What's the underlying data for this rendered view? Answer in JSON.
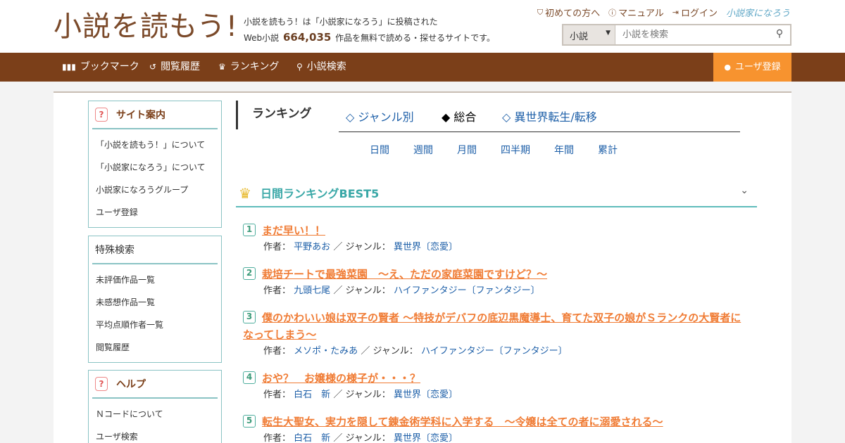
{
  "header": {
    "logo_main": "小説を読もう",
    "logo_mark": "!",
    "tagline_line1": "小説を読もう！は「小説家になろう」に投稿された",
    "tagline_prefix": "Web小説",
    "work_count": "664,035",
    "tagline_suffix": "作品を無料で読める・探せるサイトです。",
    "links": [
      "初めての方へ",
      "マニュアル",
      "ログイン"
    ],
    "partner_logo": "小説家になろう",
    "search": {
      "type": "小説",
      "placeholder": "小説を検索"
    }
  },
  "nav": {
    "items": [
      "ブックマーク",
      "閲覧履歴",
      "ランキング",
      "小説検索"
    ],
    "register": "ユーザ登録"
  },
  "sidebar": {
    "site_guide": {
      "title": "サイト案内",
      "items": [
        "「小説を読もう！」について",
        "「小説家になろう」について",
        "小説家になろうグループ",
        "ユーザ登録"
      ]
    },
    "special_search": {
      "title": "特殊検索",
      "items": [
        "未評価作品一覧",
        "未感想作品一覧",
        "平均点順作者一覧",
        "閲覧履歴"
      ]
    },
    "help": {
      "title": "ヘルプ",
      "items": [
        "Ｎコードについて",
        "ユーザ検索"
      ]
    }
  },
  "ranking": {
    "heading": "ランキング",
    "tabs": [
      "◇ ジャンル別",
      "◆ 総合",
      "◇ 異世界転生/転移"
    ],
    "periods": [
      "日間",
      "週間",
      "月間",
      "四半期",
      "年間",
      "累計"
    ],
    "best_title": "日間ランキングBEST5",
    "author_label": "作者：",
    "genre_label": "／ ジャンル：",
    "entries": [
      {
        "num": "1",
        "title": "まだ早い！！",
        "author": "平野あお",
        "genre": "異世界〔恋愛〕"
      },
      {
        "num": "2",
        "title": "栽培チートで最強菜園　～え、ただの家庭菜園ですけど？～",
        "author": "九頭七尾",
        "genre": "ハイファンタジー〔ファンタジー〕"
      },
      {
        "num": "3",
        "title": "僕のかわいい娘は双子の賢者 ～特技がデバフの底辺黒魔導士、育てた双子の娘がＳランクの大賢者になってしまう～",
        "author": "メソポ・たみあ",
        "genre": "ハイファンタジー〔ファンタジー〕"
      },
      {
        "num": "4",
        "title": "おや？　お嬢様の様子が・・・？",
        "author": "白石　新",
        "genre": "異世界〔恋愛〕"
      },
      {
        "num": "5",
        "title": "転生大聖女、実力を隠して錬金術学科に入学する　～令嬢は全ての者に溺愛される～",
        "author": "白石　新",
        "genre": "異世界〔恋愛〕"
      }
    ]
  },
  "colors": {
    "brand_brown": "#7b3f19",
    "accent_orange": "#f7932f",
    "teal": "#3aa8a7",
    "link_blue": "#1d5fa8",
    "title_orange": "#f07c35"
  }
}
